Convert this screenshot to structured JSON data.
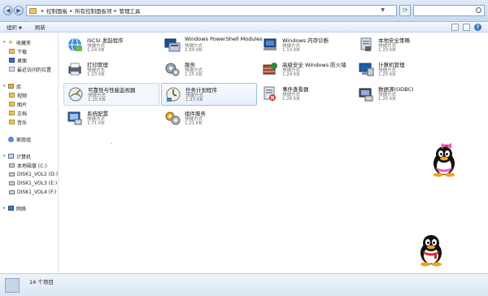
{
  "window": {
    "breadcrumb": [
      "控制面板",
      "所有控制面板项",
      "管理工具"
    ]
  },
  "toolbar": {
    "organize": "组织",
    "refresh": "刷新"
  },
  "sidebar": {
    "favorites": {
      "label": "收藏夹",
      "items": [
        "下载",
        "桌面",
        "最近访问的位置"
      ]
    },
    "libraries": {
      "label": "库",
      "items": [
        "视频",
        "图片",
        "文档",
        "音乐"
      ]
    },
    "homegroup": "家庭组",
    "computer": {
      "label": "计算机",
      "items": [
        "本地磁盘 (C:)",
        "DISK1_VOL2 (D:)",
        "DISK1_VOL3 (E:)",
        "DISK1_VOL4 (F:)"
      ]
    },
    "network": "网络"
  },
  "items": [
    {
      "title": "iSCSI 发起程序",
      "sub": "快捷方式",
      "size": "1.24 KB",
      "icon": "iscsi-icon"
    },
    {
      "title": "Windows PowerShell Modules",
      "sub": "快捷方式",
      "size": "2.69 KB",
      "icon": "powershell-icon"
    },
    {
      "title": "Windows 内存诊断",
      "sub": "快捷方式",
      "size": "1.13 KB",
      "icon": "memory-diagnostic-icon"
    },
    {
      "title": "本地安全策略",
      "sub": "快捷方式",
      "size": "1.23 KB",
      "icon": "security-policy-icon"
    },
    {
      "title": "打印管理",
      "sub": "快捷方式",
      "size": "1.23 KB",
      "icon": "print-management-icon"
    },
    {
      "title": "服务",
      "sub": "快捷方式",
      "size": "1.25 KB",
      "icon": "services-icon"
    },
    {
      "title": "高级安全 Windows 防火墙",
      "sub": "快捷方式",
      "size": "1.24 KB",
      "icon": "firewall-icon"
    },
    {
      "title": "计算机管理",
      "sub": "快捷方式",
      "size": "1.25 KB",
      "icon": "computer-management-icon"
    },
    {
      "title": "可靠性与性能监视器",
      "sub": "快捷方式",
      "size": "1.20 KB",
      "icon": "performance-monitor-icon"
    },
    {
      "title": "任务计划程序",
      "sub": "快捷方式",
      "size": "1.23 KB",
      "icon": "task-scheduler-icon"
    },
    {
      "title": "事件查看器",
      "sub": "快捷方式",
      "size": "1.26 KB",
      "icon": "event-viewer-icon"
    },
    {
      "title": "数据源(ODBC)",
      "sub": "快捷方式",
      "size": "1.25 KB",
      "icon": "odbc-icon"
    },
    {
      "title": "系统配置",
      "sub": "快捷方式",
      "size": "1.71 KB",
      "icon": "system-config-icon"
    },
    {
      "title": "组件服务",
      "sub": "快捷方式",
      "size": "1.21 KB",
      "icon": "component-services-icon"
    }
  ],
  "status": {
    "count": "14 个项目"
  }
}
